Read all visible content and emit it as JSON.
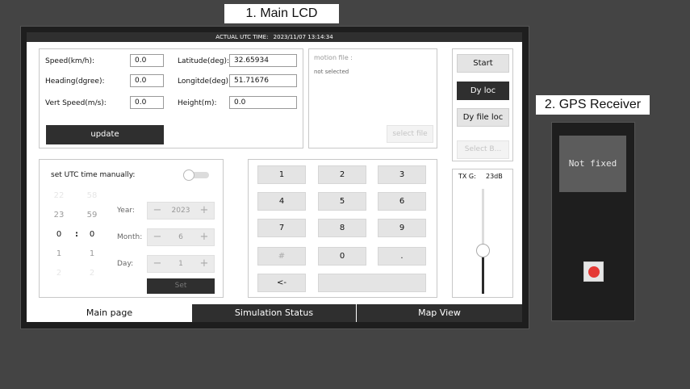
{
  "captions": {
    "lcd": "1. Main LCD",
    "gps": "2. GPS Receiver"
  },
  "utc_bar": {
    "label": "ACTUAL UTC TIME:",
    "value": "2023/11/07 13:14:34"
  },
  "motion": {
    "speed_label": "Speed(km/h):",
    "speed_value": "0.0",
    "heading_label": "Heading(dgree):",
    "heading_value": "0.0",
    "vert_speed_label": "Vert Speed(m/s):",
    "vert_speed_value": "0.0",
    "latitude_label": "Latitude(deg):",
    "latitude_value": "32.65934",
    "longitude_label": "Longitde(deg):",
    "longitude_value": "51.71676",
    "height_label": "Height(m):",
    "height_value": "0.0",
    "update_label": "update"
  },
  "file": {
    "title": "motion file :",
    "status": "not selected",
    "select_label": "select file"
  },
  "controls": {
    "start": "Start",
    "dy_loc": "Dy loc",
    "dy_file_loc": "Dy file loc",
    "select_b": "Select B..."
  },
  "time": {
    "title": "set UTC time manually:",
    "toggle_on": false,
    "hours": [
      "22",
      "23",
      "0",
      "1",
      "2"
    ],
    "minutes": [
      "58",
      "59",
      "0",
      "1",
      "2"
    ],
    "colon": ":",
    "year_label": "Year:",
    "year_value": "2023",
    "month_label": "Month:",
    "month_value": "6",
    "day_label": "Day:",
    "day_value": "1",
    "set_label": "Set",
    "minus": "−",
    "plus": "+"
  },
  "keypad": {
    "keys": [
      "1",
      "2",
      "3",
      "4",
      "5",
      "6",
      "7",
      "8",
      "9",
      "#",
      "0",
      ".",
      "<-",
      ""
    ]
  },
  "tx": {
    "label": "TX G:",
    "value": "23dB",
    "slider_fraction": 0.4
  },
  "tabs": {
    "main": "Main page",
    "sim": "Simulation Status",
    "map": "Map View"
  },
  "gps": {
    "status": "Not fixed",
    "led_color": "#e53935"
  }
}
